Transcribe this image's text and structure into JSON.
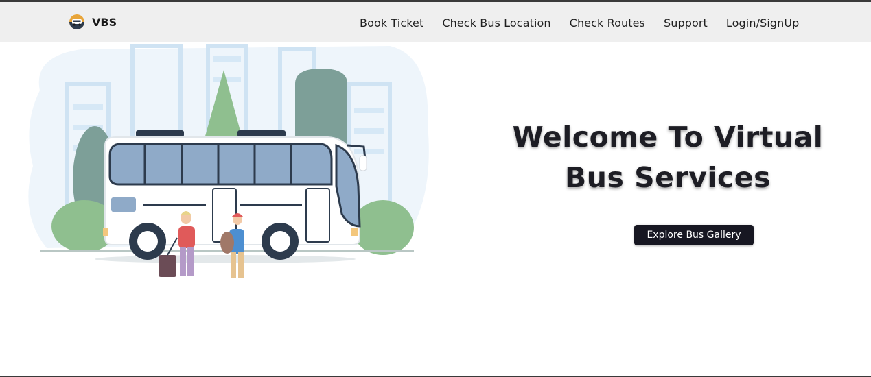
{
  "brand": {
    "logo_icon": "bus-logo-icon",
    "name": "VBS"
  },
  "nav": {
    "items": [
      {
        "label": "Book Ticket"
      },
      {
        "label": "Check Bus Location"
      },
      {
        "label": "Check Routes"
      },
      {
        "label": "Support"
      },
      {
        "label": "Login/SignUp"
      }
    ]
  },
  "hero": {
    "title": "Welcome To Virtual Bus Services",
    "cta_label": "Explore Bus Gallery",
    "illustration_icon": "bus-travelers-illustration"
  },
  "colors": {
    "navbar_bg": "#efefef",
    "button_bg": "#171722",
    "title_text": "#1d1d24",
    "bus_window": "#8faac8",
    "foliage": "#8fbf8f"
  }
}
